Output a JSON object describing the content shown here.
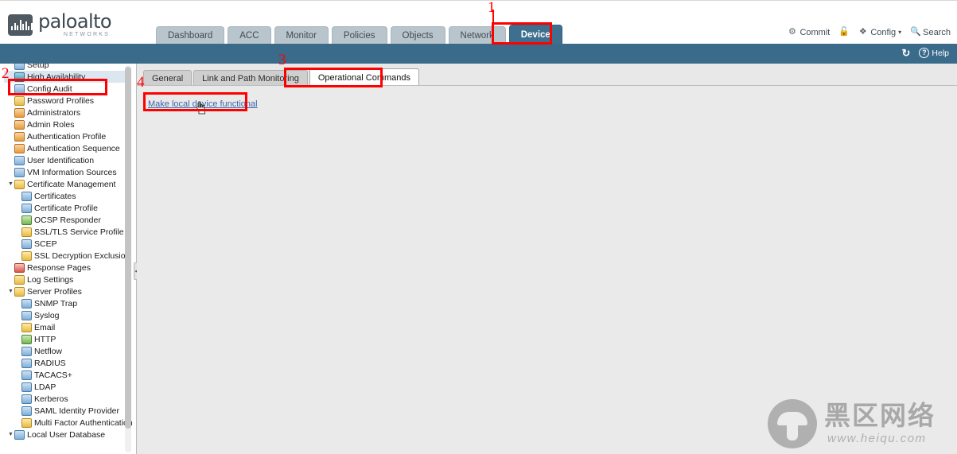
{
  "brand": {
    "name": "paloalto",
    "tagline": "NETWORKS",
    "logo_icon": "paloalto-logo-icon"
  },
  "main_nav": {
    "tabs": [
      {
        "label": "Dashboard",
        "active": false
      },
      {
        "label": "ACC",
        "active": false
      },
      {
        "label": "Monitor",
        "active": false
      },
      {
        "label": "Policies",
        "active": false
      },
      {
        "label": "Objects",
        "active": false
      },
      {
        "label": "Network",
        "active": false
      },
      {
        "label": "Device",
        "active": true
      }
    ]
  },
  "header_actions": [
    {
      "label": "Commit",
      "icon": "commit-icon"
    },
    {
      "label": "",
      "icon": "lock-open-icon"
    },
    {
      "label": "Config",
      "icon": "config-icon",
      "caret": "▾"
    },
    {
      "label": "Search",
      "icon": "search-icon"
    }
  ],
  "blue_bar_actions": [
    {
      "label": "",
      "icon": "refresh-icon"
    },
    {
      "label": "Help",
      "icon": "help-icon"
    }
  ],
  "sidebar": {
    "items": [
      {
        "label": "Setup",
        "indent": 1,
        "icon": "setup-icon",
        "icon_class": "ic-blue",
        "arrow": "",
        "selected": false
      },
      {
        "label": "High Availability",
        "indent": 1,
        "icon": "ha-icon",
        "icon_class": "ic-teal",
        "arrow": "",
        "selected": true
      },
      {
        "label": "Config Audit",
        "indent": 1,
        "icon": "config-audit-icon",
        "icon_class": "ic-blue",
        "arrow": "",
        "selected": false
      },
      {
        "label": "Password Profiles",
        "indent": 1,
        "icon": "password-icon",
        "icon_class": "ic-yellow",
        "arrow": "",
        "selected": false
      },
      {
        "label": "Administrators",
        "indent": 1,
        "icon": "user-icon",
        "icon_class": "ic-orange",
        "arrow": "",
        "selected": false
      },
      {
        "label": "Admin Roles",
        "indent": 1,
        "icon": "admin-role-icon",
        "icon_class": "ic-orange",
        "arrow": "",
        "selected": false
      },
      {
        "label": "Authentication Profile",
        "indent": 1,
        "icon": "auth-profile-icon",
        "icon_class": "ic-orange",
        "arrow": "",
        "selected": false
      },
      {
        "label": "Authentication Sequence",
        "indent": 1,
        "icon": "auth-seq-icon",
        "icon_class": "ic-orange",
        "arrow": "",
        "selected": false
      },
      {
        "label": "User Identification",
        "indent": 1,
        "icon": "user-id-icon",
        "icon_class": "ic-blue",
        "arrow": "",
        "selected": false
      },
      {
        "label": "VM Information Sources",
        "indent": 1,
        "icon": "vm-info-icon",
        "icon_class": "ic-blue",
        "arrow": "",
        "selected": false
      },
      {
        "label": "Certificate Management",
        "indent": 1,
        "icon": "folder-icon",
        "icon_class": "ic-yellow",
        "arrow": "▼",
        "selected": false
      },
      {
        "label": "Certificates",
        "indent": 2,
        "icon": "certificate-icon",
        "icon_class": "ic-blue",
        "arrow": "",
        "selected": false
      },
      {
        "label": "Certificate Profile",
        "indent": 2,
        "icon": "certificate-icon",
        "icon_class": "ic-blue",
        "arrow": "",
        "selected": false
      },
      {
        "label": "OCSP Responder",
        "indent": 2,
        "icon": "ocsp-icon",
        "icon_class": "ic-green",
        "arrow": "",
        "selected": false
      },
      {
        "label": "SSL/TLS Service Profile",
        "indent": 2,
        "icon": "lock-icon",
        "icon_class": "ic-yellow",
        "arrow": "",
        "selected": false
      },
      {
        "label": "SCEP",
        "indent": 2,
        "icon": "scep-icon",
        "icon_class": "ic-blue",
        "arrow": "",
        "selected": false
      },
      {
        "label": "SSL Decryption Exclusion",
        "indent": 2,
        "icon": "lock-icon",
        "icon_class": "ic-yellow",
        "arrow": "",
        "selected": false
      },
      {
        "label": "Response Pages",
        "indent": 1,
        "icon": "response-page-icon",
        "icon_class": "ic-red",
        "arrow": "",
        "selected": false
      },
      {
        "label": "Log Settings",
        "indent": 1,
        "icon": "log-settings-icon",
        "icon_class": "ic-yellow",
        "arrow": "",
        "selected": false
      },
      {
        "label": "Server Profiles",
        "indent": 1,
        "icon": "folder-icon",
        "icon_class": "ic-yellow",
        "arrow": "▼",
        "selected": false
      },
      {
        "label": "SNMP Trap",
        "indent": 2,
        "icon": "snmp-icon",
        "icon_class": "ic-blue",
        "arrow": "",
        "selected": false
      },
      {
        "label": "Syslog",
        "indent": 2,
        "icon": "syslog-icon",
        "icon_class": "ic-blue",
        "arrow": "",
        "selected": false
      },
      {
        "label": "Email",
        "indent": 2,
        "icon": "email-icon",
        "icon_class": "ic-yellow",
        "arrow": "",
        "selected": false
      },
      {
        "label": "HTTP",
        "indent": 2,
        "icon": "http-icon",
        "icon_class": "ic-green",
        "arrow": "",
        "selected": false
      },
      {
        "label": "Netflow",
        "indent": 2,
        "icon": "netflow-icon",
        "icon_class": "ic-blue",
        "arrow": "",
        "selected": false
      },
      {
        "label": "RADIUS",
        "indent": 2,
        "icon": "radius-icon",
        "icon_class": "ic-blue",
        "arrow": "",
        "selected": false
      },
      {
        "label": "TACACS+",
        "indent": 2,
        "icon": "tacacs-icon",
        "icon_class": "ic-blue",
        "arrow": "",
        "selected": false
      },
      {
        "label": "LDAP",
        "indent": 2,
        "icon": "ldap-icon",
        "icon_class": "ic-blue",
        "arrow": "",
        "selected": false
      },
      {
        "label": "Kerberos",
        "indent": 2,
        "icon": "kerberos-icon",
        "icon_class": "ic-blue",
        "arrow": "",
        "selected": false
      },
      {
        "label": "SAML Identity Provider",
        "indent": 2,
        "icon": "saml-icon",
        "icon_class": "ic-blue",
        "arrow": "",
        "selected": false
      },
      {
        "label": "Multi Factor Authentication",
        "indent": 2,
        "icon": "mfa-icon",
        "icon_class": "ic-yellow",
        "arrow": "",
        "selected": false
      },
      {
        "label": "Local User Database",
        "indent": 1,
        "icon": "local-user-db-icon",
        "icon_class": "ic-blue",
        "arrow": "▼",
        "selected": false
      }
    ]
  },
  "content": {
    "sub_tabs": [
      {
        "label": "General",
        "active": false
      },
      {
        "label": "Link and Path Monitoring",
        "active": false
      },
      {
        "label": "Operational Commands",
        "active": true
      }
    ],
    "command_link": "Make local device functional",
    "cursor_icon": "hand-pointer-cursor"
  },
  "annotations": [
    {
      "num": "1"
    },
    {
      "num": "2"
    },
    {
      "num": "3"
    },
    {
      "num": "4"
    }
  ],
  "watermark": {
    "cn_text": "黑区网络",
    "url_text": "www.heiqu.com",
    "logo_icon": "mushroom-logo-icon"
  },
  "colors": {
    "brand_blue": "#3a6b8a",
    "active_tab": "#3f6f8f",
    "nav_tab": "#b9c5cc",
    "gray_strip": "#8b9097",
    "annotation_red": "#ff0000",
    "link_blue": "#3a64a8",
    "selection": "#dbe6f0"
  }
}
